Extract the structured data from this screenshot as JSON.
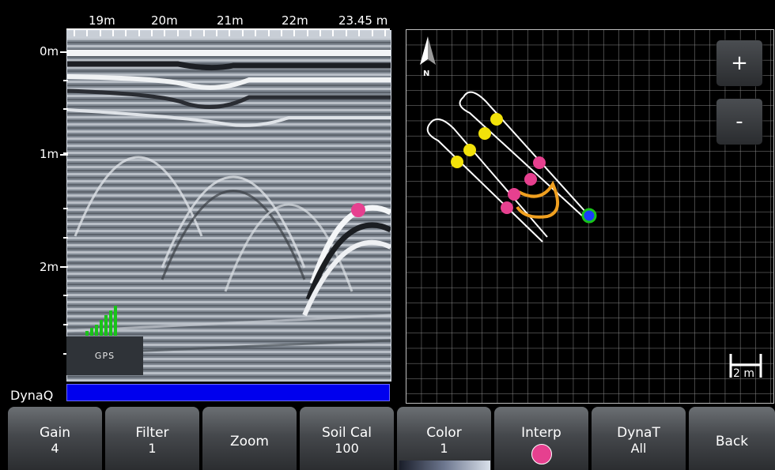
{
  "gpr": {
    "distance_ticks": [
      "19m",
      "20m",
      "21m",
      "22m",
      "23.45 m"
    ],
    "depth_ticks": [
      "0m",
      "1m",
      "2m"
    ],
    "gps_label": "GPS",
    "dynaq_label": "DynaQ"
  },
  "map": {
    "zoom_in_label": "+",
    "zoom_out_label": "-",
    "north_label": "N",
    "scale_label": "2 m"
  },
  "toolbar": {
    "buttons": [
      {
        "label": "Gain",
        "value": "4"
      },
      {
        "label": "Filter",
        "value": "1"
      },
      {
        "label": "Zoom",
        "value": ""
      },
      {
        "label": "Soil Cal",
        "value": "100"
      },
      {
        "label": "Color",
        "value": "1"
      },
      {
        "label": "Interp",
        "value": ""
      },
      {
        "label": "DynaT",
        "value": "All"
      },
      {
        "label": "Back",
        "value": ""
      }
    ]
  },
  "colors": {
    "interp_marker": "#e6408f",
    "yellow_marker": "#f2e20a",
    "track_highlight": "#f0a020",
    "dynaq_bar": "#0000ee",
    "position_marker": "#1a3cff",
    "gps_signal": "#19c419"
  }
}
